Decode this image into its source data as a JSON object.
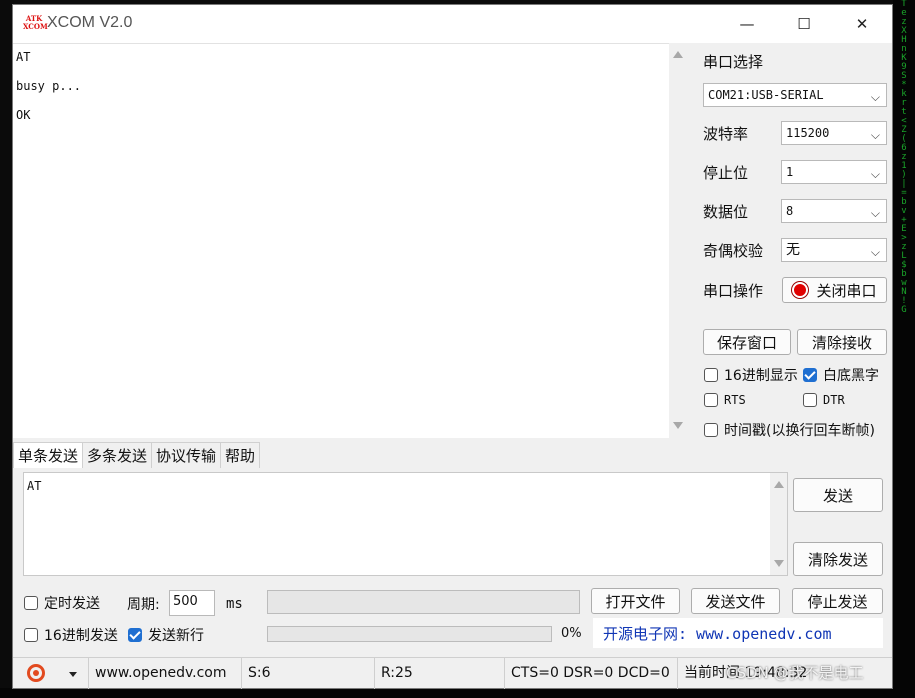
{
  "app": {
    "logo_text_top": "ATK",
    "logo_text_bottom": "XCOM",
    "title": "XCOM V2.0",
    "controls": {
      "minimize": "—",
      "maximize": "☐",
      "close": "✕"
    }
  },
  "receive": {
    "lines": [
      "AT",
      "busy p...",
      "OK"
    ]
  },
  "serial_settings": {
    "port_label": "串口选择",
    "port_value": "COM21:USB-SERIAL",
    "baud_label": "波特率",
    "baud_value": "115200",
    "stopbits_label": "停止位",
    "stopbits_value": "1",
    "databits_label": "数据位",
    "databits_value": "8",
    "parity_label": "奇偶校验",
    "parity_value": "无",
    "operation_label": "串口操作",
    "close_port_label": "关闭串口"
  },
  "receive_options": {
    "save_window_label": "保存窗口",
    "clear_receive_label": "清除接收",
    "hex_display_label": "16进制显示",
    "hex_display_checked": false,
    "white_black_label": "白底黑字",
    "white_black_checked": true,
    "rts_label": "RTS",
    "dtr_label": "DTR",
    "timestamp_label": "时间戳(以换行回车断帧)"
  },
  "tabs": [
    {
      "label": "单条发送",
      "active": true
    },
    {
      "label": "多条发送",
      "active": false
    },
    {
      "label": "协议传输",
      "active": false
    },
    {
      "label": "帮助",
      "active": false
    }
  ],
  "send": {
    "text": "AT",
    "send_button": "发送",
    "clear_send_button": "清除发送",
    "timed_send_label": "定时发送",
    "period_label": "周期:",
    "period_value": "500",
    "period_unit": "ms",
    "open_file_button": "打开文件",
    "send_file_button": "发送文件",
    "stop_send_button": "停止发送",
    "hex_send_label": "16进制发送",
    "newline_label": "发送新行",
    "newline_checked": true,
    "progress_text": "0%",
    "progress_value": 0,
    "website_text": "开源电子网: www.openedv.com"
  },
  "statusbar": {
    "url": "www.openedv.com",
    "sent": "S:6",
    "received": "R:25",
    "lines": "CTS=0 DSR=0 DCD=0",
    "time": "当前时间 19:48:32"
  },
  "watermark": "CSDN @我不是电工",
  "colors": {
    "accent": "#1f6fd1",
    "close_indicator": "#e00000",
    "link": "#1036b5",
    "matrix_green": "#1aa32a"
  }
}
